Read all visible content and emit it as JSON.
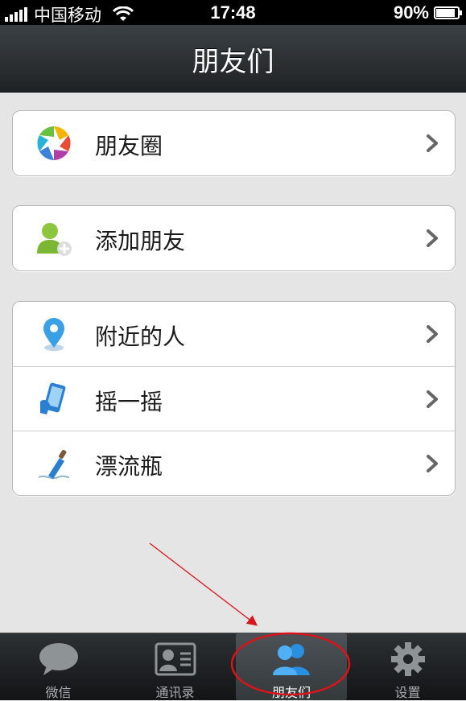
{
  "status_bar": {
    "carrier": "中国移动",
    "time": "17:48",
    "battery_percent": "90%",
    "battery_level": 0.9,
    "signal_icon": "signal-bars-icon",
    "wifi_icon": "wifi-icon"
  },
  "navbar": {
    "title": "朋友们"
  },
  "groups": [
    {
      "items": [
        {
          "label": "朋友圈",
          "icon": "moments-aperture-icon"
        }
      ]
    },
    {
      "items": [
        {
          "label": "添加朋友",
          "icon": "add-friend-icon"
        }
      ]
    },
    {
      "items": [
        {
          "label": "附近的人",
          "icon": "location-pin-icon"
        },
        {
          "label": "摇一摇",
          "icon": "shake-phone-icon"
        },
        {
          "label": "漂流瓶",
          "icon": "drift-bottle-icon"
        }
      ]
    }
  ],
  "tab_bar": {
    "tabs": [
      {
        "label": "微信",
        "icon": "chat-bubble-icon",
        "active": false
      },
      {
        "label": "通讯录",
        "icon": "contacts-card-icon",
        "active": false
      },
      {
        "label": "朋友们",
        "icon": "friends-icon",
        "active": true
      },
      {
        "label": "设置",
        "icon": "gear-icon",
        "active": false
      }
    ]
  },
  "colors": {
    "background": "#e5e5e5",
    "navbar": "#2b2f32",
    "accent_blue": "#3aa0e6",
    "annotation_red": "#d9141a"
  }
}
